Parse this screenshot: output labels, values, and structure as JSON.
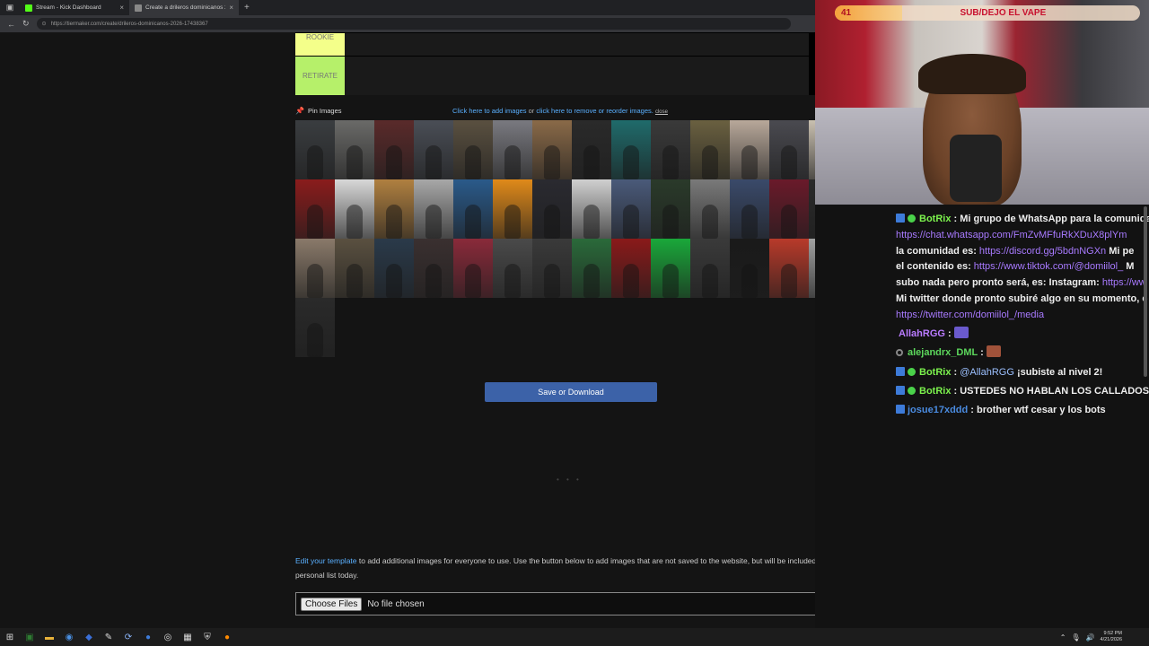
{
  "browser": {
    "tabs": [
      {
        "label": "Stream - Kick Dashboard",
        "favicon_color": "#53fc18"
      },
      {
        "label": "Create a drileros dominicanos 20...",
        "favicon_color": "#888888"
      }
    ],
    "url": "https://tiermaker.com/create/drileros-dominicanos-2026-17438367"
  },
  "tiers": [
    {
      "label": "ROOKIE",
      "color": "#f4ff8a"
    },
    {
      "label": "RETIRATE",
      "color": "#b6f06a"
    }
  ],
  "pin": {
    "label": "Pin Images",
    "add_link": "Click here to add images",
    "or_text": " or ",
    "reorder_link": "click here to remove or reorder images.",
    "close": "close"
  },
  "thumb_colors": [
    "#3a3d40",
    "#6a6a68",
    "#5a2a2a",
    "#4a4e56",
    "#5a5040",
    "#7a7a80",
    "#8a6a48",
    "#2a2a2a",
    "#1f6b6b",
    "#3a3a3a",
    "#6a6040",
    "#b8a89a",
    "#4a4a50",
    "#c9c0b0",
    "#8a1c1c",
    "#d8d8d8",
    "#b08040",
    "#a8a8a8",
    "#2a5a8a",
    "#e08a1a",
    "#2a2a30",
    "#d0d0d0",
    "#4a5a7a",
    "#2a3a2a",
    "#7a7a7a",
    "#3a4a6a",
    "#6a1a2a",
    "#2a2a2a",
    "#8a7a6a",
    "#5a5040",
    "#2a3a4a",
    "#3a3030",
    "#8a2a3a",
    "#4a4a4a",
    "#3a3a3a",
    "#2a6a3a",
    "#8a1a1a",
    "#1aa83a",
    "#3a3a3a",
    "#1a1a1a",
    "#b83a2a",
    "#a0a0a0",
    "#2a2a2a"
  ],
  "save_button": "Save or Download",
  "edit_note": {
    "link": "Edit your template",
    "text": " to add additional images for everyone to use. Use the button below to add images that are not saved to the website, but will be included in your personal list today."
  },
  "file_input": {
    "button": "Choose Files",
    "status": "No file chosen"
  },
  "stream_overlay": {
    "count": "41",
    "goal": "SUB/DEJO EL VAPE",
    "progress": 0.22
  },
  "chat": {
    "m1_user": "BotRix",
    "m1_text_a": "Mi grupo de WhatsApp para la comunidad",
    "m1_link_a": "https://chat.whatsapp.com/FmZvMFfuRkXDuX8plYm",
    "m1_text_b": "la comunidad es: ",
    "m1_link_b": "https://discord.gg/5bdnNGXn",
    "m1_text_c": " Mi pe",
    "m1_text_d": "el contenido es: ",
    "m1_link_c": "https://www.tiktok.com/@domiilol_",
    "m1_text_e": " M",
    "m1_text_f": "subo nada pero pronto será, es: Instagram: ",
    "m1_link_d": "https://ww",
    "m1_text_g": "Mi twitter donde pronto subiré algo en su momento, e",
    "m1_link_e": "https://twitter.com/domiilol_/media",
    "m2_user": "AllahRGG",
    "m3_user": "alejandrx_DML",
    "m4_user": "BotRix",
    "m4_mention": "@AllahRGG",
    "m4_text": " ¡subiste al nivel 2!",
    "m5_user": "BotRix",
    "m5_text": "USTEDES NO HABLAN LOS CALLADOS?",
    "m6_user": "josue17xddd",
    "m6_text": "brother wtf cesar y los bots",
    "separator": " : "
  },
  "taskbar": {
    "time": "9:52 PM",
    "date": "4/21/2026"
  }
}
